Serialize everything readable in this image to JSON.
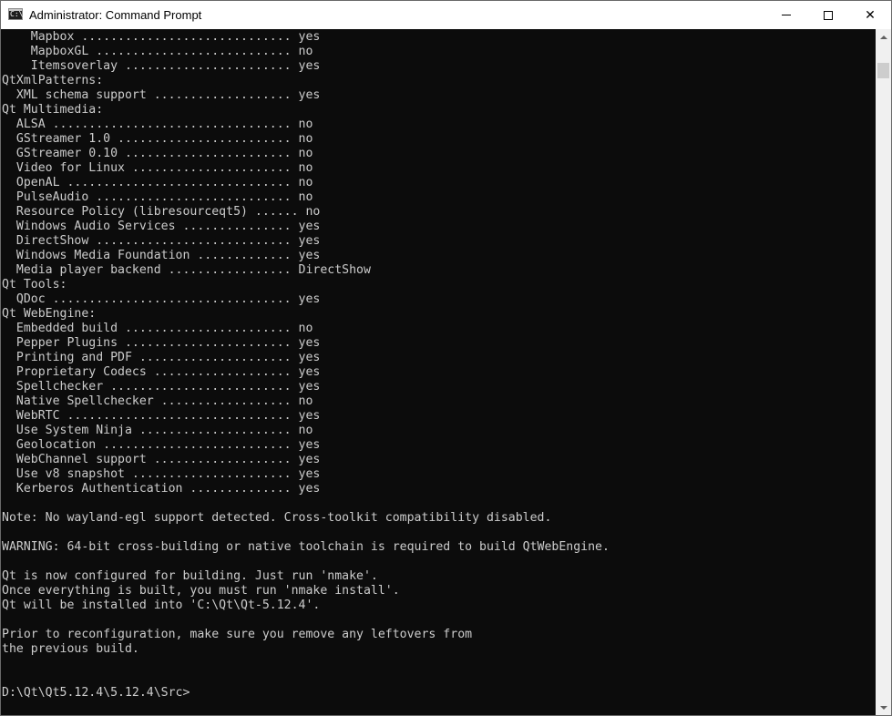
{
  "window": {
    "title": "Administrator: Command Prompt",
    "icon": "cmd-icon",
    "icon_glyph": "C:\\"
  },
  "controls": {
    "minimize": "minimize-icon",
    "maximize": "maximize-icon",
    "close": "close-icon",
    "close_glyph": "✕"
  },
  "console": {
    "lines": [
      "    Mapbox ............................. yes",
      "    MapboxGL ........................... no",
      "    Itemsoverlay ....................... yes",
      "QtXmlPatterns:",
      "  XML schema support ................... yes",
      "Qt Multimedia:",
      "  ALSA ................................. no",
      "  GStreamer 1.0 ........................ no",
      "  GStreamer 0.10 ....................... no",
      "  Video for Linux ...................... no",
      "  OpenAL ............................... no",
      "  PulseAudio ........................... no",
      "  Resource Policy (libresourceqt5) ...... no",
      "  Windows Audio Services ............... yes",
      "  DirectShow ........................... yes",
      "  Windows Media Foundation ............. yes",
      "  Media player backend ................. DirectShow",
      "Qt Tools:",
      "  QDoc ................................. yes",
      "Qt WebEngine:",
      "  Embedded build ....................... no",
      "  Pepper Plugins ....................... yes",
      "  Printing and PDF ..................... yes",
      "  Proprietary Codecs ................... yes",
      "  Spellchecker ......................... yes",
      "  Native Spellchecker .................. no",
      "  WebRTC ............................... yes",
      "  Use System Ninja ..................... no",
      "  Geolocation .......................... yes",
      "  WebChannel support ................... yes",
      "  Use v8 snapshot ...................... yes",
      "  Kerberos Authentication .............. yes",
      "",
      "Note: No wayland-egl support detected. Cross-toolkit compatibility disabled.",
      "",
      "WARNING: 64-bit cross-building or native toolchain is required to build QtWebEngine.",
      "",
      "Qt is now configured for building. Just run 'nmake'.",
      "Once everything is built, you must run 'nmake install'.",
      "Qt will be installed into 'C:\\Qt\\Qt-5.12.4'.",
      "",
      "Prior to reconfiguration, make sure you remove any leftovers from",
      "the previous build.",
      "",
      "",
      "D:\\Qt\\Qt5.12.4\\5.12.4\\Src>"
    ]
  },
  "scrollbar": {
    "up": "scroll-up-arrow-icon",
    "down": "scroll-down-arrow-icon"
  },
  "colors": {
    "console_bg": "#0c0c0c",
    "console_text": "#cccccc",
    "titlebar_bg": "#ffffff"
  }
}
